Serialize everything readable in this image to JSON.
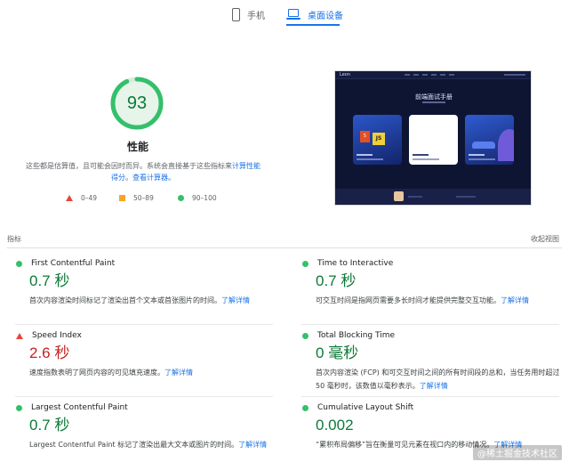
{
  "tabs": {
    "mobile_label": "手机",
    "desktop_label": "桌面设备"
  },
  "score": {
    "value": "93",
    "fraction": 0.93,
    "title": "性能",
    "desc_part1": "这些都是估算值，且可能会因时而异。系统会直接基于这些指标来",
    "desc_link1": "计算性能得分",
    "desc_sep": "。",
    "desc_link2": "查看计算器。"
  },
  "legend": [
    {
      "range": "0–49",
      "shape": "triangle",
      "color": "#e8453c"
    },
    {
      "range": "50–89",
      "shape": "square",
      "color": "#f5a623"
    },
    {
      "range": "90–100",
      "shape": "circle",
      "color": "#34c06b"
    }
  ],
  "preview": {
    "logo_text": "Leon",
    "title": "前端面试手册"
  },
  "metrics_section": {
    "label": "指标",
    "toggle": "收起视图"
  },
  "metrics": [
    {
      "name": "First Contentful Paint",
      "value": "0.7 秒",
      "status": "good",
      "desc": "首次内容渲染时间标记了渲染出首个文本或首张图片的时间。",
      "link": "了解详情"
    },
    {
      "name": "Speed Index",
      "value": "2.6 秒",
      "status": "poor",
      "desc": "速度指数表明了网页内容的可见填充速度。",
      "link": "了解详情"
    },
    {
      "name": "Largest Contentful Paint",
      "value": "0.7 秒",
      "status": "good",
      "desc": "Largest Contentful Paint 标记了渲染出最大文本或图片的时间。",
      "link": "了解详情"
    },
    {
      "name": "Time to Interactive",
      "value": "0.7 秒",
      "status": "good",
      "desc": "可交互时间是指网页需要多长时间才能提供完整交互功能。",
      "link": "了解详情"
    },
    {
      "name": "Total Blocking Time",
      "value": "0 毫秒",
      "status": "good",
      "desc": "首次内容渲染 (FCP) 和可交互时间之间的所有时间段的总和，当任务用时超过 50 毫秒时，该数值以毫秒表示。",
      "link": "了解详情"
    },
    {
      "name": "Cumulative Layout Shift",
      "value": "0.002",
      "status": "good",
      "desc": "“累积布局偏移”旨在衡量可见元素在视口内的移动情况。",
      "link": "了解详情"
    }
  ],
  "watermark": "@稀土掘金技术社区",
  "colors": {
    "good": "#0c7a37",
    "poor": "#c5221f",
    "accent": "#1a73e8"
  }
}
